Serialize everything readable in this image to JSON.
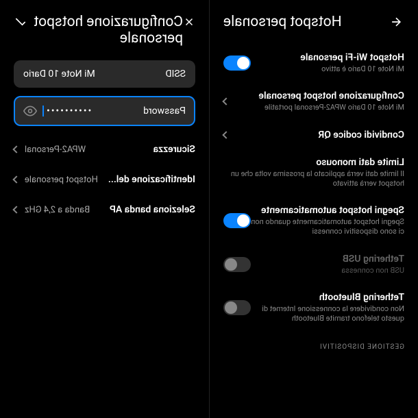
{
  "leftPane": {
    "title": "Hotspot personale",
    "wifiHotspot": {
      "title": "Hotspot Wi-Fi personale",
      "sub": "Mi Note 10 Dario è attivo",
      "on": true
    },
    "config": {
      "title": "Configurazione hotspot personale",
      "sub": "Mi Note 10 Dario WPA2-Personal portatile"
    },
    "qr": {
      "title": "Condividi codice QR"
    },
    "dataLimit": {
      "title": "Limite dati monouso",
      "sub": "Il limite dati verrà applicato la prossima volta che un hotspot verrà attivato"
    },
    "autoOff": {
      "title": "Spegni hotspot automaticamente",
      "sub": "Spegni hotspot automaticamente quando non ci sono dispositivi connessi",
      "on": true
    },
    "usb": {
      "title": "Tethering USB",
      "sub": "USB non connessa",
      "on": false
    },
    "bt": {
      "title": "Tethering Bluetooth",
      "sub": "Non condividere la connessione Internet di questo telefono tramite Bluetooth",
      "on": false
    },
    "sectionLabel": "GESTIONE DISPOSITIVI"
  },
  "rightPane": {
    "title": "Configurazione hotspot personale",
    "ssid": {
      "label": "SSID",
      "value": "Mi Note 10 Dario"
    },
    "password": {
      "label": "Password",
      "value": "••••••••••"
    },
    "security": {
      "label": "Sicurezza",
      "value": "WPA2-Personal"
    },
    "identification": {
      "label": "Identificazione del...",
      "value": "Hotspot personale"
    },
    "band": {
      "label": "Seleziona banda AP",
      "value": "Banda a 2,4 GHz"
    }
  }
}
